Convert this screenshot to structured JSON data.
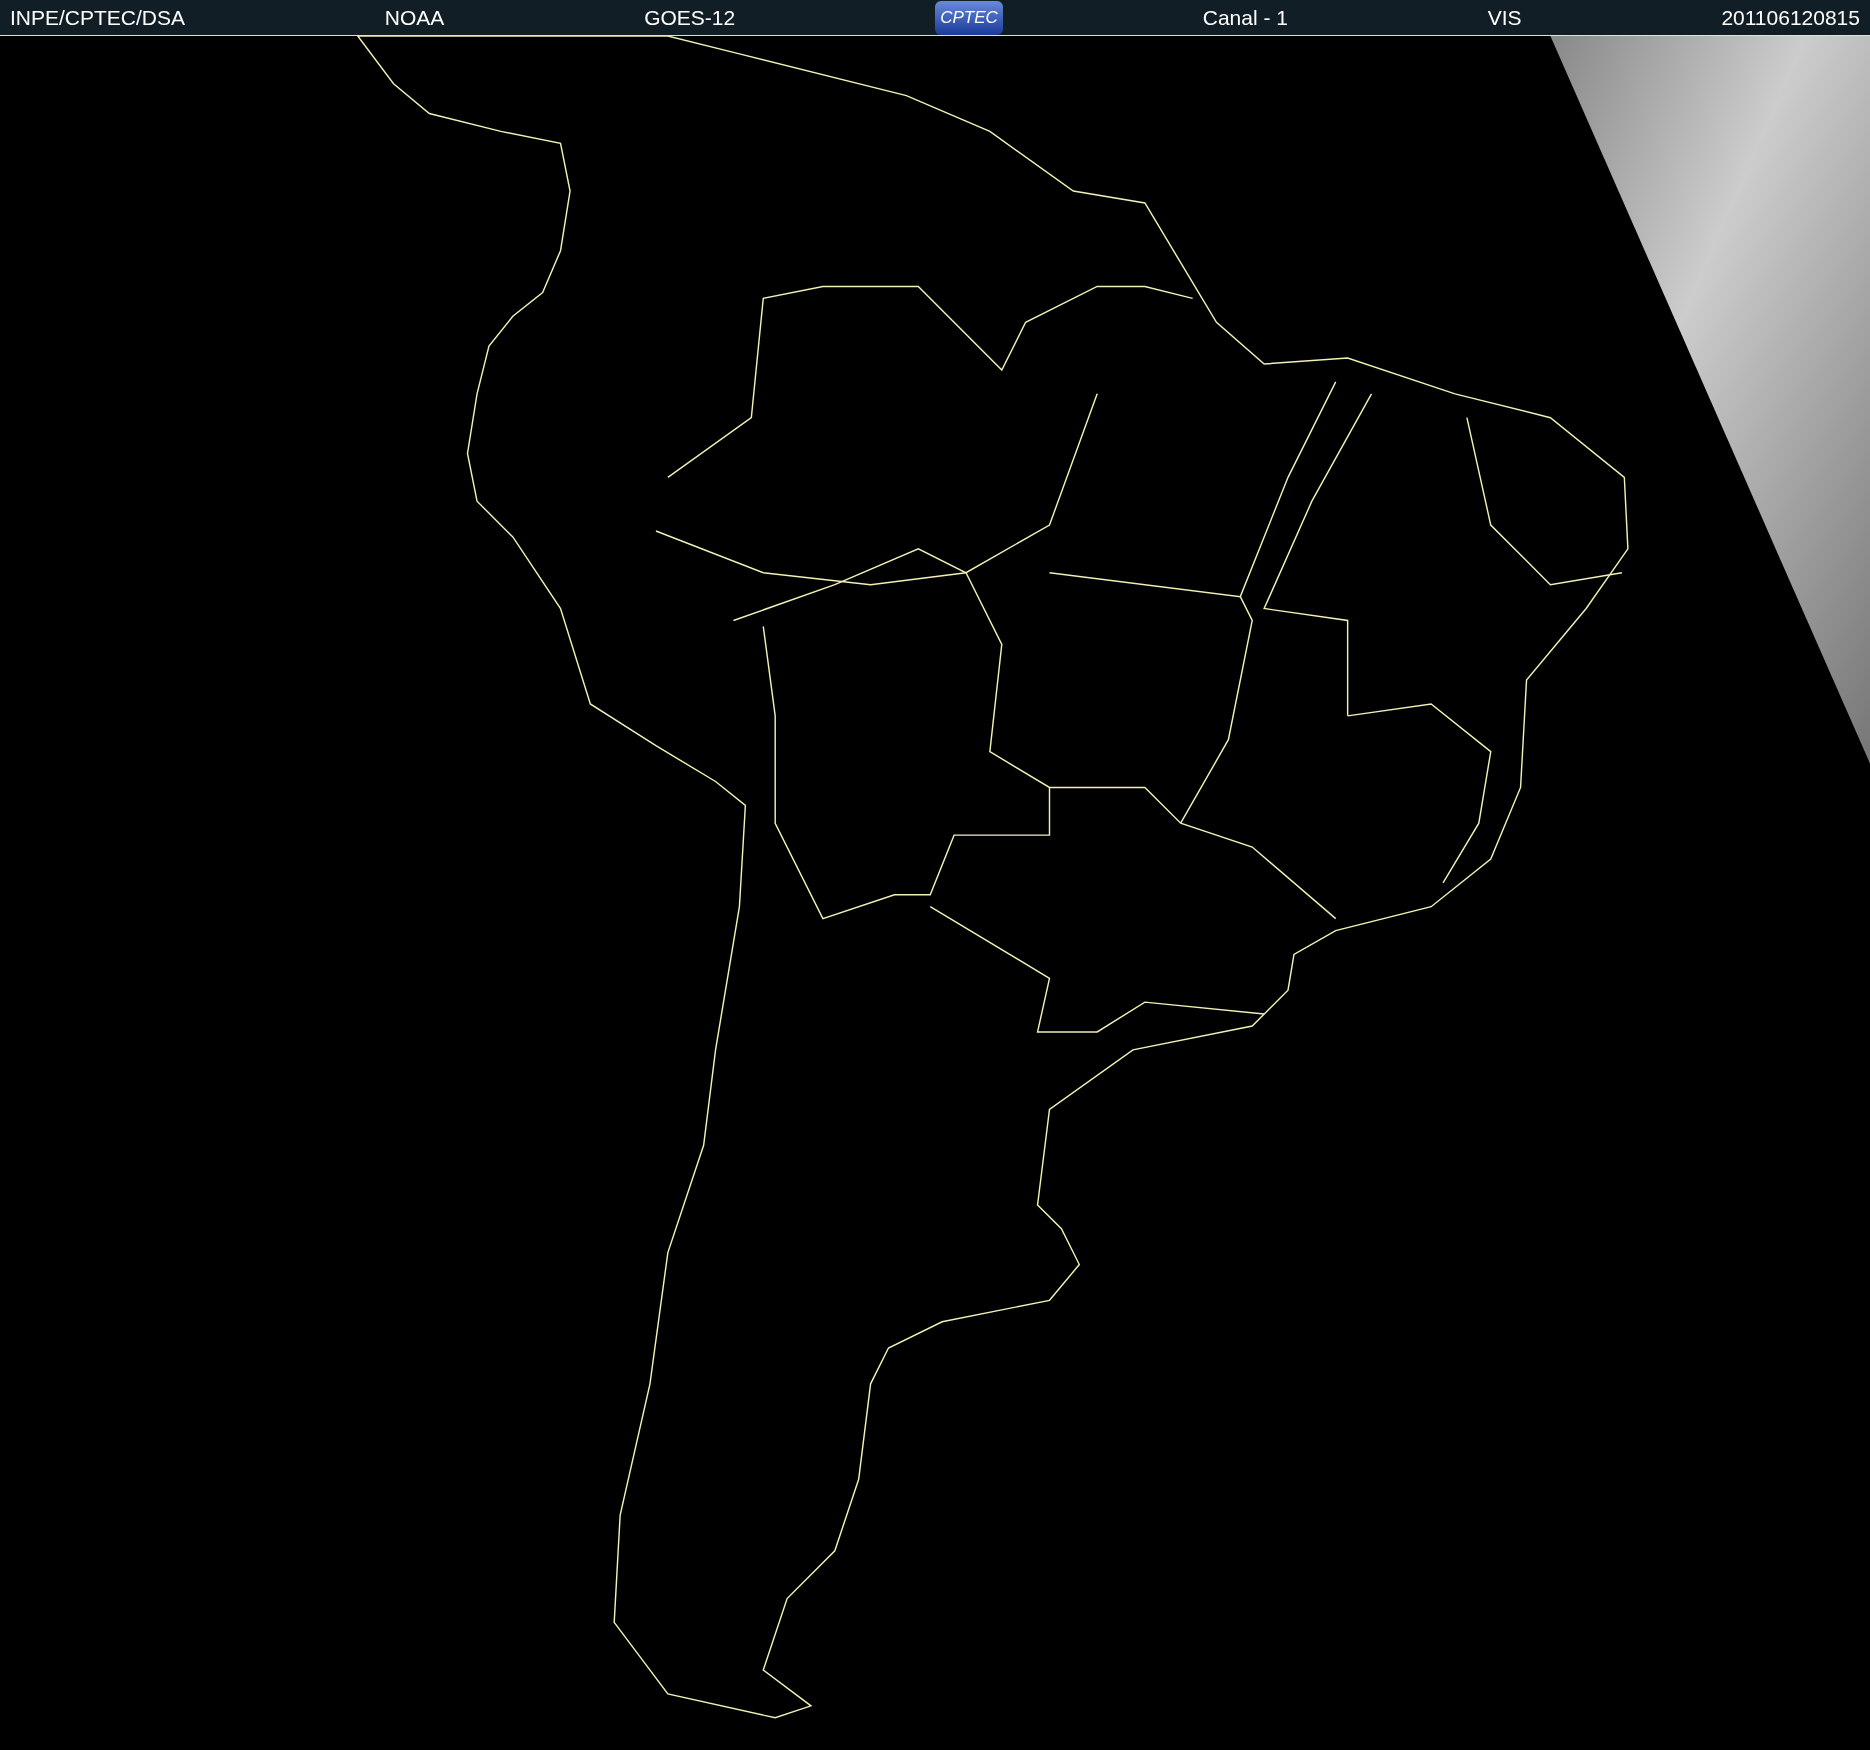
{
  "header": {
    "items": [
      {
        "kind": "text",
        "text": "INPE/CPTEC/DSA"
      },
      {
        "kind": "text",
        "text": "NOAA"
      },
      {
        "kind": "text",
        "text": "GOES-12"
      },
      {
        "kind": "logo",
        "text": "CPTEC"
      },
      {
        "kind": "text",
        "text": "Canal - 1"
      },
      {
        "kind": "text",
        "text": "VIS"
      },
      {
        "kind": "text",
        "text": "201106120815"
      }
    ]
  }
}
